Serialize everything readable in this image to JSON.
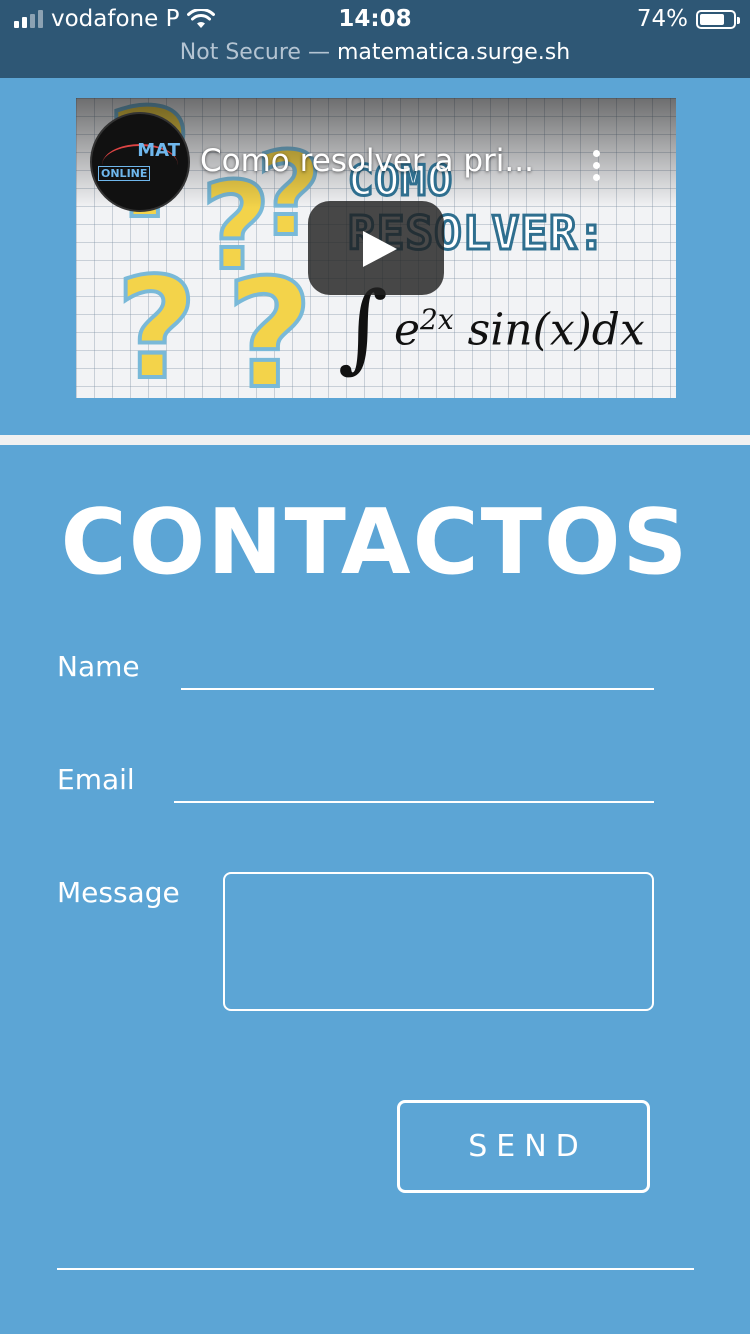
{
  "status_bar": {
    "carrier": "vodafone P",
    "time": "14:08",
    "battery_percent": "74%",
    "battery_level": 0.74
  },
  "url_bar": {
    "security": "Not Secure —",
    "host": "matematica.surge.sh"
  },
  "video": {
    "title": "Como resolver a pri...",
    "channel_logo_main": "MAT",
    "channel_logo_sub": "ONLINE",
    "thumb_word_1": "COMO",
    "thumb_word_2": "RESOLVER:",
    "formula_integral": "∫",
    "formula_base": "e",
    "formula_exponent": "2x",
    "formula_rest": "sin(x)dx",
    "play_icon": "play-icon",
    "menu_icon": "more-vert-icon"
  },
  "contact": {
    "heading": "CONTACTOS",
    "name_label": "Name",
    "name_value": "",
    "email_label": "Email",
    "email_value": "",
    "message_label": "Message",
    "message_value": "",
    "send_label": "SEND"
  },
  "colors": {
    "page_bg": "#5ca5d5",
    "topbar_bg": "#2e5775",
    "divider": "#f1f1f1",
    "text": "#ffffff"
  }
}
